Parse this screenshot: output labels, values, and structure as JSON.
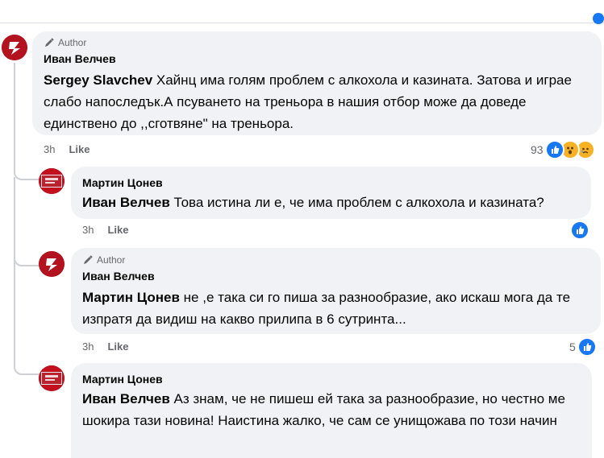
{
  "comments": [
    {
      "author_badge": "Author",
      "name": "Иван Велчев",
      "mention": "Sergey Slavchev",
      "text": "Хайнц има голям проблем с алкохола и казината. Затова и играе слабо напоследък.А псуването на треньора в нашия отбор може да доведе единствено до ,,сготвяне\" на треньора.",
      "time": "3h",
      "like_label": "Like",
      "reaction_count": "93",
      "reaction_icons": [
        "like-icon",
        "wow-icon",
        "sad-icon"
      ]
    },
    {
      "name": "Мартин Цонев",
      "mention": "Иван Велчев",
      "text": "Това истина ли е, че има проблем с алкохола и казината?",
      "time": "3h",
      "like_label": "Like",
      "reaction_icons": [
        "like-icon"
      ]
    },
    {
      "author_badge": "Author",
      "name": "Иван Велчев",
      "mention": "Мартин Цонев",
      "text": "не ,е така си го пиша за разнообразие, ако искаш мога да те изпратя да видиш на какво прилипа в 6 сутринта...",
      "time": "3h",
      "like_label": "Like",
      "reaction_count": "5",
      "reaction_icons": [
        "like-icon"
      ]
    },
    {
      "name": "Мартин Цонев",
      "mention": "Иван Велчев",
      "text": "Аз знам, че не пишеш ей така за разнообразие, но честно ме шокира тази новина! Наистина жалко, че сам се унищожава по този начин"
    }
  ],
  "colors": {
    "bubble": "#f0f2f5",
    "meta_text": "#65676b",
    "like_blue": "#1877f2",
    "reaction_yellow": "#f7b125",
    "avatar_red": "#c2101e"
  }
}
